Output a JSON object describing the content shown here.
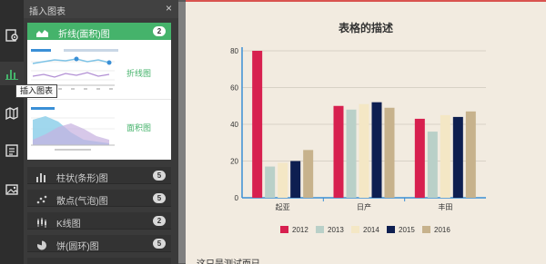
{
  "toolbar": {
    "tools": [
      {
        "name": "settings-tool-icon"
      },
      {
        "name": "insert-chart-tool-icon"
      },
      {
        "name": "map-tool-icon"
      },
      {
        "name": "text-tool-icon"
      },
      {
        "name": "image-tool-icon"
      }
    ],
    "tooltip": "插入图表"
  },
  "panel": {
    "title": "插入图表",
    "close": "×",
    "active_category": {
      "label": "折线(面积)图",
      "count": "2"
    },
    "thumbnails": [
      {
        "label": "折线图"
      },
      {
        "label": "面积图"
      }
    ],
    "categories": [
      {
        "label": "柱状(条形)图",
        "count": "5",
        "icon": "bar-chart-icon"
      },
      {
        "label": "散点(气泡)图",
        "count": "5",
        "icon": "scatter-chart-icon"
      },
      {
        "label": "K线图",
        "count": "2",
        "icon": "candlestick-chart-icon"
      },
      {
        "label": "饼(圆环)图",
        "count": "5",
        "icon": "pie-chart-icon"
      }
    ]
  },
  "colors": {
    "accent_green": "#45b36b",
    "series": [
      "#d7204f",
      "#b9d0c8",
      "#f4e7c5",
      "#0e1f51",
      "#c7b28c"
    ]
  },
  "chart_data": {
    "type": "bar",
    "title": "表格的描述",
    "categories": [
      "起亚",
      "日产",
      "丰田"
    ],
    "series": [
      {
        "name": "2012",
        "values": [
          80,
          50,
          43
        ]
      },
      {
        "name": "2013",
        "values": [
          17,
          48,
          36
        ]
      },
      {
        "name": "2014",
        "values": [
          19,
          51,
          45
        ]
      },
      {
        "name": "2015",
        "values": [
          20,
          52,
          44
        ]
      },
      {
        "name": "2016",
        "values": [
          26,
          49,
          47
        ]
      }
    ],
    "yticks": [
      "0",
      "20",
      "40",
      "60",
      "80"
    ],
    "ylim": [
      0,
      80
    ],
    "grid": true,
    "legend": "bottom"
  },
  "content": {
    "below_text": "这只是测试而已"
  }
}
